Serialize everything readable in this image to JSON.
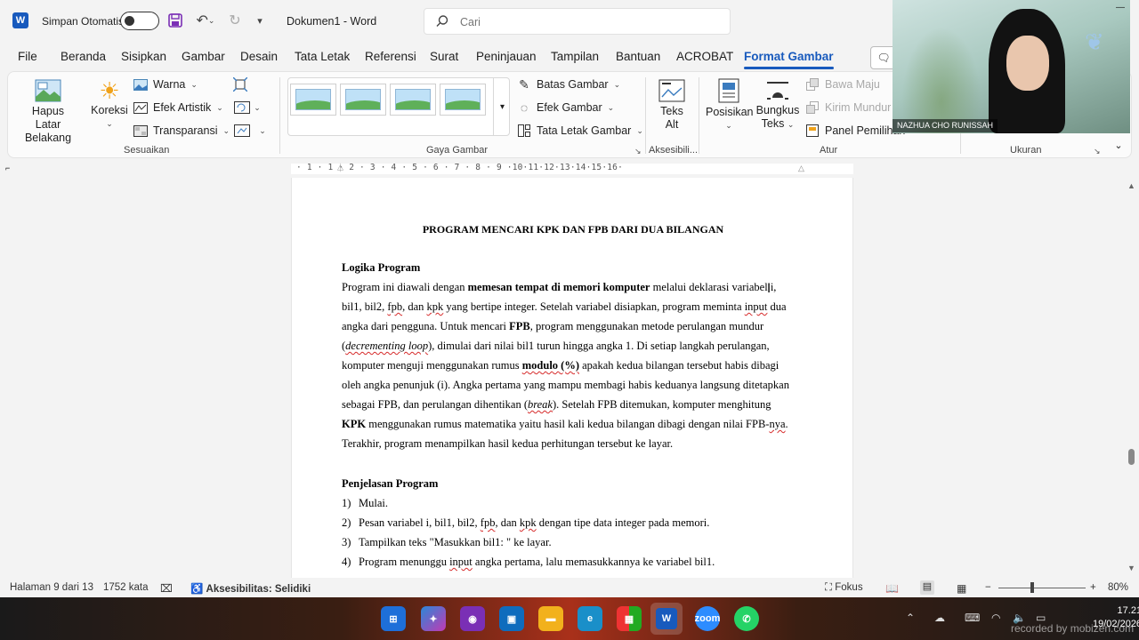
{
  "titlebar": {
    "autosave_label": "Simpan Otomatis",
    "doc_title": "Dokumen1  -  Word",
    "search_placeholder": "Cari"
  },
  "tabs": [
    {
      "label": "File"
    },
    {
      "label": "Beranda"
    },
    {
      "label": "Sisipkan"
    },
    {
      "label": "Gambar"
    },
    {
      "label": "Desain"
    },
    {
      "label": "Tata Letak"
    },
    {
      "label": "Referensi"
    },
    {
      "label": "Surat"
    },
    {
      "label": "Peninjauan"
    },
    {
      "label": "Tampilan"
    },
    {
      "label": "Bantuan"
    },
    {
      "label": "ACROBAT"
    },
    {
      "label": "Format Gambar"
    }
  ],
  "ribbon": {
    "hapus_latar": "Hapus Latar",
    "belakang": "Belakang",
    "koreksi": "Koreksi",
    "warna": "Warna",
    "efek_artistik": "Efek Artistik",
    "transparansi": "Transparansi",
    "group_sesuaikan": "Sesuaikan",
    "batas_gambar": "Batas Gambar",
    "efek_gambar": "Efek Gambar",
    "tata_letak_gambar": "Tata Letak Gambar",
    "group_gaya": "Gaya Gambar",
    "teks": "Teks",
    "alt": "Alt",
    "group_aksesibilitas": "Aksesibili...",
    "posisikan": "Posisikan",
    "bungkus": "Bungkus",
    "teks2": "Teks",
    "bawa_maju": "Bawa Maju",
    "kirim_mundur": "Kirim Mundur",
    "panel_pemilihan": "Panel Pemilihan",
    "group_atur": "Atur",
    "group_ukuran": "Ukuran"
  },
  "ruler": {
    "marks": "· 1 · 1 · 2 · 3 · 4 · 5 · 6 · 7 · 8 · 9 ·10·11·12·13·14·15·16·"
  },
  "document": {
    "title": "PROGRAM MENCARI KPK DAN FPB DARI DUA BILANGAN",
    "heading_logika": "Logika Program",
    "para": {
      "l1a": "Program ini diawali dengan ",
      "l1b": "memesan tempat di memori komputer",
      "l1c": " melalui deklarasi variabel i,",
      "l2a": "bil1, bil2, ",
      "l2b": "fpb",
      "l2c": ", dan ",
      "l2d": "kpk",
      "l2e": " yang bertipe integer. Setelah variabel disiapkan, program meminta ",
      "l2f": "input",
      "l2g": " dua",
      "l3a": "angka dari pengguna. Untuk mencari ",
      "l3b": "FPB",
      "l3c": ", program menggunakan metode perulangan mundur",
      "l4a": "(",
      "l4b": "decrementing loop",
      "l4c": "), dimulai dari nilai bil1 turun hingga angka 1. Di setiap langkah perulangan,",
      "l5a": "komputer menguji menggunakan rumus ",
      "l5b": "modulo (%)",
      "l5c": " apakah kedua bilangan tersebut habis dibagi",
      "l6": "oleh angka penunjuk (i). Angka pertama yang mampu membagi habis keduanya langsung ditetapkan",
      "l7a": "sebagai FPB, dan perulangan dihentikan (",
      "l7b": "break",
      "l7c": "). Setelah FPB ditemukan, komputer menghitung",
      "l8a": "KPK",
      "l8b": " menggunakan rumus matematika yaitu hasil kali kedua bilangan dibagi dengan nilai FPB-",
      "l8c": "nya",
      "l8d": ".",
      "l9": "Terakhir, program menampilkan hasil kedua perhitungan tersebut ke layar."
    },
    "heading_penjelasan": "Penjelasan Program",
    "list": {
      "n1": "1)",
      "t1": "Mulai.",
      "n2": "2)",
      "t2a": "Pesan variabel i, bil1, bil2, ",
      "t2b": "fpb",
      "t2c": ", dan ",
      "t2d": "kpk",
      "t2e": " dengan tipe data integer pada memori.",
      "n3": "3)",
      "t3": "Tampilkan teks \"Masukkan bil1: \" ke layar.",
      "n4": "4)",
      "t4a": "Program menunggu ",
      "t4b": "input",
      "t4c": " angka pertama, lalu memasukkannya ke variabel bil1."
    }
  },
  "statusbar": {
    "page": "Halaman 9 dari 13",
    "words": "1752 kata",
    "accessibility": "Aksesibilitas: Selidiki",
    "focus": "Fokus",
    "zoom": "80%"
  },
  "taskbar": {
    "time": "17.21",
    "date": "19/02/2026",
    "watermark": "recorded by mobizen.com"
  },
  "webcam": {
    "name": "NAZHUA CHO RUNISSAH"
  },
  "colors": {
    "accent": "#185abd",
    "spell_underline": "#d62a2a"
  }
}
